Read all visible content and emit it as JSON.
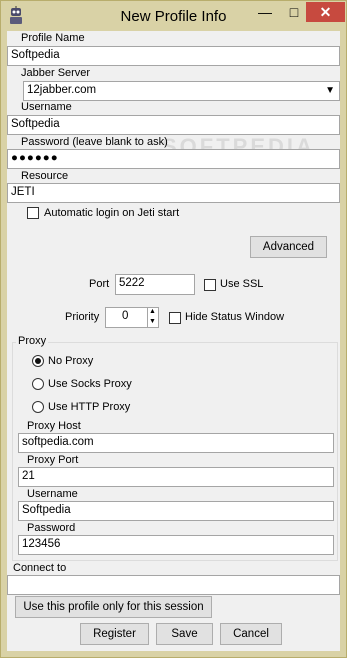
{
  "window": {
    "title": "New Profile Info",
    "minimize_glyph": "—",
    "maximize_glyph": "□",
    "close_glyph": "✕",
    "icon": "jeti-robot-icon"
  },
  "profile": {
    "profile_name_label": "Profile Name",
    "profile_name_value": "Softpedia",
    "jabber_server_label": "Jabber Server",
    "jabber_server_value": "12jabber.com",
    "username_label": "Username",
    "username_value": "Softpedia",
    "password_label": "Password (leave blank to ask)",
    "password_value": "●●●●●●",
    "resource_label": "Resource",
    "resource_value": "JETI",
    "auto_login_label": "Automatic login on Jeti start"
  },
  "connection": {
    "advanced_label": "Advanced",
    "port_label": "Port",
    "port_value": "5222",
    "use_ssl_label": "Use SSL",
    "priority_label": "Priority",
    "priority_value": "0",
    "hide_status_label": "Hide Status Window"
  },
  "proxy": {
    "group_label": "Proxy",
    "options": [
      "No Proxy",
      "Use Socks Proxy",
      "Use HTTP Proxy"
    ],
    "selected": "No Proxy",
    "host_label": "Proxy Host",
    "host_value": "softpedia.com",
    "port_label": "Proxy Port",
    "port_value": "21",
    "username_label": "Username",
    "username_value": "Softpedia",
    "password_label": "Password",
    "password_value": "123456"
  },
  "connect_to": {
    "label": "Connect to",
    "value": ""
  },
  "buttons": {
    "session_only": "Use this profile only for this session",
    "register": "Register",
    "save": "Save",
    "cancel": "Cancel"
  },
  "watermark": "SOFTPEDIA",
  "colors": {
    "frame": "#d9d2a6",
    "close_button": "#c74a3f",
    "client_bg": "#f0f0f0"
  }
}
